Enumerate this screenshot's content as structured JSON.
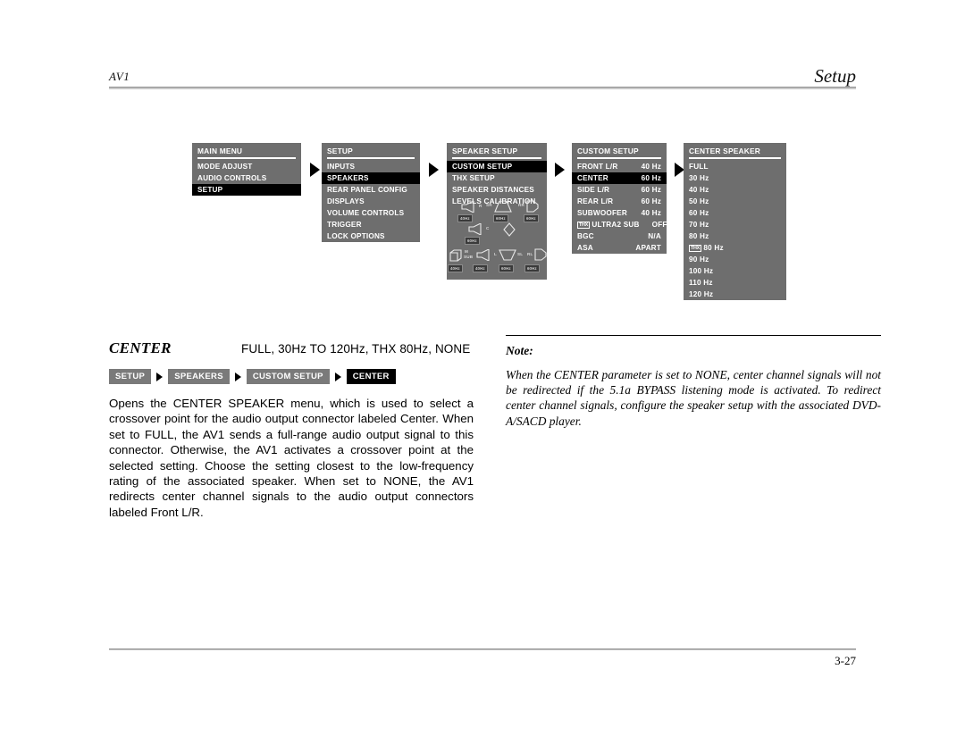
{
  "header": {
    "left": "AV1",
    "right": "Setup"
  },
  "footer": {
    "page": "3-27"
  },
  "osd_menus": {
    "main_menu": {
      "title": "MAIN MENU",
      "items": [
        {
          "label": "MODE ADJUST",
          "selected": false
        },
        {
          "label": "AUDIO CONTROLS",
          "selected": false
        },
        {
          "label": "SETUP",
          "selected": true
        }
      ]
    },
    "setup": {
      "title": "SETUP",
      "items": [
        {
          "label": "INPUTS",
          "selected": false
        },
        {
          "label": "SPEAKERS",
          "selected": true
        },
        {
          "label": "REAR PANEL CONFIG",
          "selected": false
        },
        {
          "label": "DISPLAYS",
          "selected": false
        },
        {
          "label": "VOLUME CONTROLS",
          "selected": false
        },
        {
          "label": "TRIGGER",
          "selected": false
        },
        {
          "label": "LOCK OPTIONS",
          "selected": false
        }
      ]
    },
    "speaker_setup": {
      "title": "SPEAKER SETUP",
      "items": [
        {
          "label": "CUSTOM SETUP",
          "selected": true
        },
        {
          "label": "THX SETUP",
          "selected": false
        },
        {
          "label": "SPEAKER DISTANCES",
          "selected": false
        },
        {
          "label": "LEVELS CALIBRATION",
          "selected": false
        }
      ],
      "diagram": {
        "speakers": [
          {
            "id": "R",
            "freq": "40Hz"
          },
          {
            "id": "SR",
            "freq": "60Hz"
          },
          {
            "id": "RR",
            "freq": "60Hz"
          },
          {
            "id": "C",
            "freq": "60Hz"
          },
          {
            "id": "SUB",
            "freq": "40Hz",
            "prefix": "M"
          },
          {
            "id": "L",
            "freq": "40Hz"
          },
          {
            "id": "SL",
            "freq": "60Hz"
          },
          {
            "id": "RL",
            "freq": "60Hz"
          }
        ]
      }
    },
    "custom_setup": {
      "title": "CUSTOM SETUP",
      "rows": [
        {
          "label": "FRONT L/R",
          "value": "40 Hz",
          "selected": false,
          "thx": false
        },
        {
          "label": "CENTER",
          "value": "60 Hz",
          "selected": true,
          "thx": false
        },
        {
          "label": "SIDE L/R",
          "value": "60 Hz",
          "selected": false,
          "thx": false
        },
        {
          "label": "REAR L/R",
          "value": "60 Hz",
          "selected": false,
          "thx": false
        },
        {
          "label": "SUBWOOFER",
          "value": "40 Hz",
          "selected": false,
          "thx": false
        },
        {
          "label": "ULTRA2 SUB",
          "value": "OFF",
          "selected": false,
          "thx": true
        },
        {
          "label": "BGC",
          "value": "N/A",
          "selected": false,
          "thx": false
        },
        {
          "label": "ASA",
          "value": "APART",
          "selected": false,
          "thx": false
        }
      ]
    },
    "center_speaker": {
      "title": "CENTER SPEAKER",
      "items": [
        {
          "label": "FULL",
          "thx": false
        },
        {
          "label": "30 Hz",
          "thx": false
        },
        {
          "label": "40 Hz",
          "thx": false
        },
        {
          "label": "50 Hz",
          "thx": false
        },
        {
          "label": "60 Hz",
          "thx": false
        },
        {
          "label": "70 Hz",
          "thx": false
        },
        {
          "label": "80 Hz",
          "thx": false
        },
        {
          "label": "80 Hz",
          "thx": true
        },
        {
          "label": "90 Hz",
          "thx": false
        },
        {
          "label": "100 Hz",
          "thx": false
        },
        {
          "label": "110 Hz",
          "thx": false
        },
        {
          "label": "120 Hz",
          "thx": false
        }
      ]
    },
    "thx_badge_text": "THX"
  },
  "parameter": {
    "name": "CENTER",
    "options": "FULL, 30Hz TO 120Hz, THX 80Hz, NONE",
    "breadcrumbs": [
      "SETUP",
      "SPEAKERS",
      "CUSTOM SETUP",
      "CENTER"
    ],
    "description": "Opens the CENTER SPEAKER menu, which is used to select a crossover point for the audio output connector labeled Center. When set to FULL, the AV1 sends a full-range audio output signal to this connector. Otherwise, the AV1 activates a crossover point at the selected setting. Choose the setting closest to the low-frequency rating of the associated speaker. When set to NONE, the AV1 redirects center channel signals to the audio output connectors labeled Front L/R."
  },
  "note": {
    "heading": "Note:",
    "body": "When the CENTER parameter is set to NONE, center channel signals will not be redirected if the 5.1a BYPASS listening mode is activated. To redirect center channel signals, configure the speaker setup with the associated DVD-A/SACD player."
  }
}
